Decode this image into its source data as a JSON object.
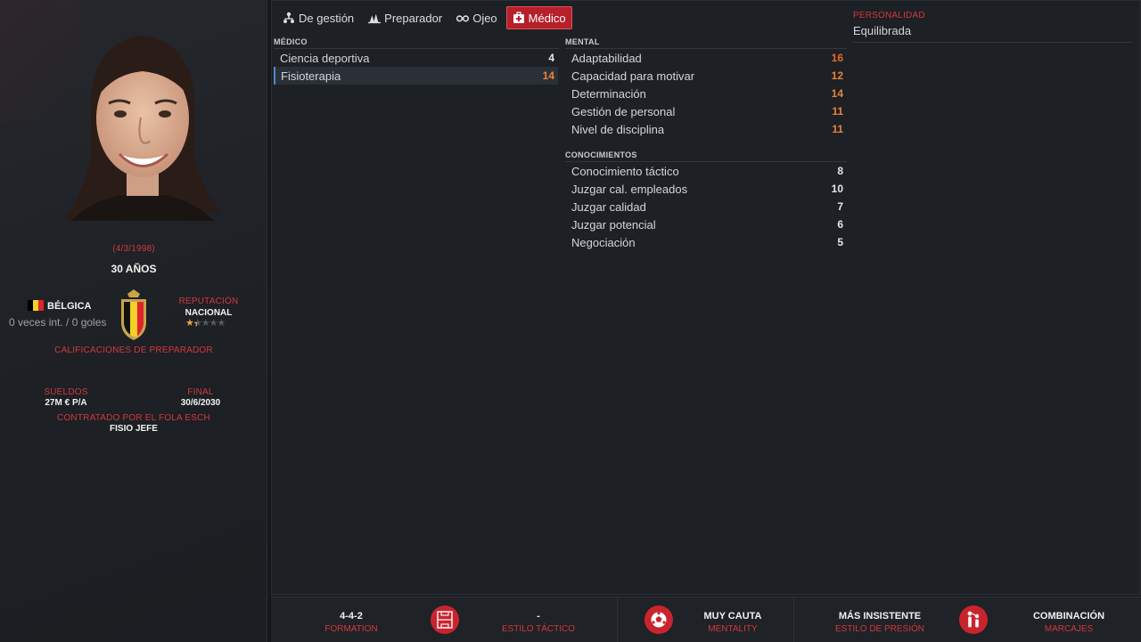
{
  "tabs": [
    {
      "label": "De gestión",
      "icon": "person-tree-icon",
      "active": false
    },
    {
      "label": "Preparador",
      "icon": "cones-icon",
      "active": false
    },
    {
      "label": "Ojeo",
      "icon": "binoculars-icon",
      "active": false
    },
    {
      "label": "Médico",
      "icon": "medical-kit-icon",
      "active": true
    }
  ],
  "profile": {
    "birth_date": "(4/3/1998)",
    "age": "30 AÑOS",
    "nation": "BÉLGICA",
    "caps": "0 veces int. / 0 goles",
    "reputation_label": "REPUTACIÓN",
    "reputation_value": "NACIONAL",
    "reputation_stars": 1.5,
    "coach_ratings_link": "CALIFICACIONES DE PREPARADOR",
    "wage_label": "SUELDOS",
    "wage_value": "27M € P/A",
    "end_label": "FINAL",
    "end_value": "30/6/2030",
    "contract_label": "CONTRATADO POR EL FOLA ESCH",
    "role": "FISIO JEFE"
  },
  "medico": {
    "title": "MÉDICO",
    "items": [
      {
        "label": "Ciencia deportiva",
        "value": "4"
      },
      {
        "label": "Fisioterapia",
        "value": "14"
      }
    ]
  },
  "mental": {
    "title": "MENTAL",
    "items": [
      {
        "label": "Adaptabilidad",
        "value": "16"
      },
      {
        "label": "Capacidad para motivar",
        "value": "12"
      },
      {
        "label": "Determinación",
        "value": "14"
      },
      {
        "label": "Gestión de personal",
        "value": "11"
      },
      {
        "label": "Nivel de disciplina",
        "value": "11"
      }
    ]
  },
  "conocimientos": {
    "title": "CONOCIMIENTOS",
    "items": [
      {
        "label": "Conocimiento táctico",
        "value": "8"
      },
      {
        "label": "Juzgar cal. empleados",
        "value": "10"
      },
      {
        "label": "Juzgar calidad",
        "value": "7"
      },
      {
        "label": "Juzgar potencial",
        "value": "6"
      },
      {
        "label": "Negociación",
        "value": "5"
      }
    ]
  },
  "personality": {
    "label": "PERSONALIDAD",
    "value": "Equilibrada"
  },
  "bottom": {
    "formation_value": "4-4-2",
    "formation_label": "FORMATION",
    "style_value": "-",
    "style_label": "ESTILO TÁCTICO",
    "mentality_value": "MUY CAUTA",
    "mentality_label": "MENTALITY",
    "press_value": "MÁS INSISTENTE",
    "press_label": "ESTILO DE PRESIÓN",
    "marking_value": "COMBINACIÓN",
    "marking_label": "MARCAJES"
  },
  "colors": {
    "accent": "#c9242e",
    "highlight": "#e8833a",
    "selected_row": "#4b8bd1"
  }
}
